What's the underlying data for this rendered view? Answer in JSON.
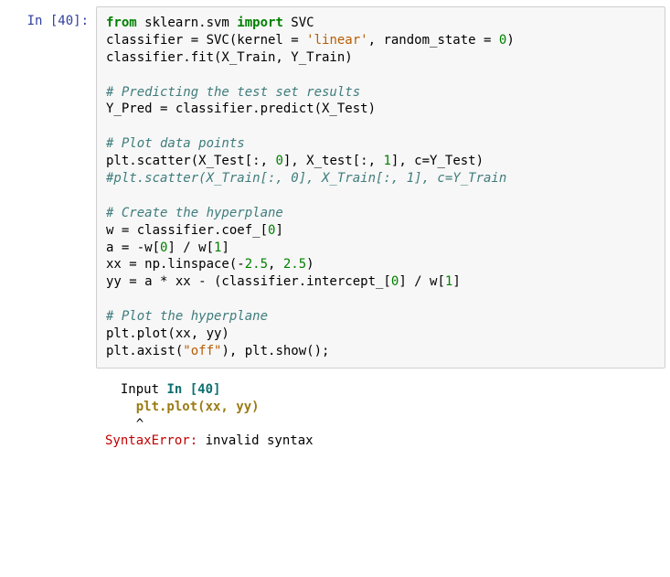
{
  "prompt": {
    "label": "In [40]:"
  },
  "code": {
    "l1a": "from",
    "l1b": " sklearn.svm ",
    "l1c": "import",
    "l1d": " SVC",
    "l2a": "classifier = SVC(kernel = ",
    "l2b": "'linear'",
    "l2c": ", random_state = ",
    "l2d": "0",
    "l2e": ")",
    "l3": "classifier.fit(X_Train, Y_Train)",
    "l4": "",
    "l5": "# Predicting the test set results",
    "l6": "Y_Pred = classifier.predict(X_Test)",
    "l7": "",
    "l8": "# Plot data points",
    "l9a": "plt.scatter(X_Test[:, ",
    "l9b": "0",
    "l9c": "], X_test[:, ",
    "l9d": "1",
    "l9e": "], c=Y_Test)",
    "l10": "#plt.scatter(X_Train[:, 0], X_Train[:, 1], c=Y_Train",
    "l11": "",
    "l12": "# Create the hyperplane",
    "l13a": "w = classifier.coef_[",
    "l13b": "0",
    "l13c": "]",
    "l14a": "a = -w[",
    "l14b": "0",
    "l14c": "] / w[",
    "l14d": "1",
    "l14e": "]",
    "l15a": "xx = np.linspace(-",
    "l15b": "2.5",
    "l15c": ", ",
    "l15d": "2.5",
    "l15e": ")",
    "l16a": "yy = a * xx - (classifier.intercept_[",
    "l16b": "0",
    "l16c": "] / w[",
    "l16d": "1",
    "l16e": "]",
    "l17": "",
    "l18": "# Plot the hyperplane",
    "l19": "plt.plot(xx, yy)",
    "l20a": "plt.axist(",
    "l20b": "\"off\"",
    "l20c": "), plt.show();"
  },
  "error": {
    "input_label": "  Input ",
    "input_loc": "In [40]",
    "code_indent": "    ",
    "code_line": "plt.plot(xx, yy)",
    "caret": "    ^",
    "name": "SyntaxError",
    "sep": ": ",
    "msg": "invalid syntax"
  }
}
